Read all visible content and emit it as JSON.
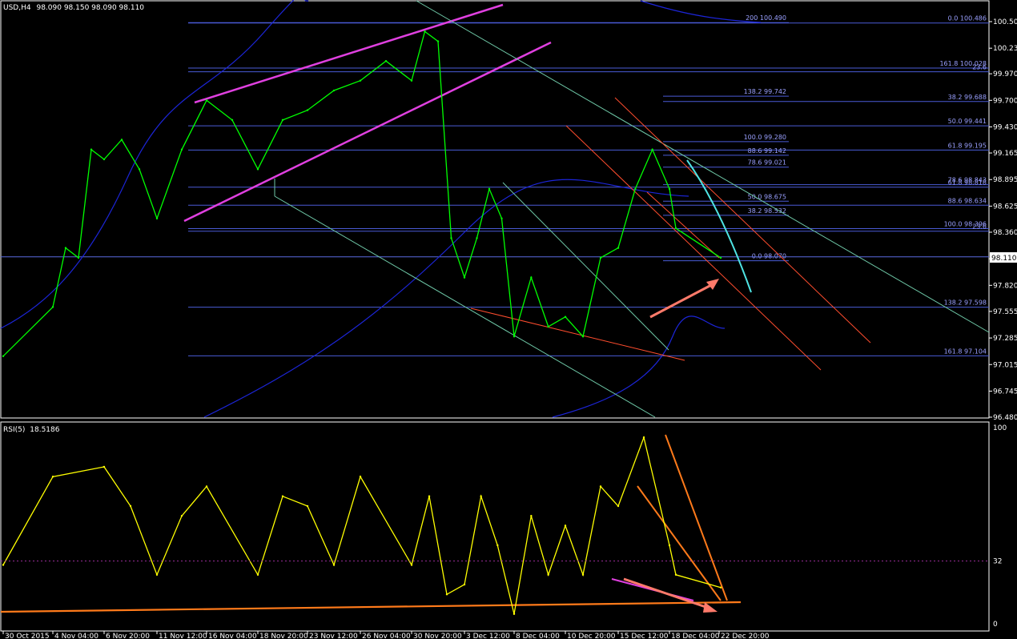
{
  "header": {
    "symbol": "USD,H4",
    "ohlc": "98.090 98.150 98.090 98.110"
  },
  "colors": {
    "background": "#000000",
    "price": "#00ff00",
    "rsi": "#ffff00",
    "fib_level": "#4a5bd6",
    "fib_text": "#9aa0ff",
    "moving_average": "#1c25d8",
    "channel": "#e040e0",
    "light_trend": "#6fc9a8",
    "orange_trend": "#ff7a1a",
    "red_trend": "#ff4d2e",
    "cyan_trend": "#4fe3e3",
    "arrow": "#ff7a6a",
    "frame": "#ffffff"
  },
  "chart_data": [
    {
      "type": "line",
      "title": "USD,H4",
      "y_axis_ticks": [
        "100.50",
        "100.23",
        "99.970",
        "99.700",
        "99.430",
        "99.165",
        "98.895",
        "98.625",
        "98.360",
        "98.090",
        "97.820",
        "97.555",
        "97.285",
        "97.015",
        "96.745",
        "96.480"
      ],
      "ylim": [
        96.48,
        100.53
      ],
      "current_price": "98.110",
      "x_axis_ticks": [
        "30 Oct 2015",
        "4 Nov 04:00",
        "6 Nov 20:00",
        "11 Nov 12:00",
        "16 Nov 04:00",
        "18 Nov 20:00",
        "23 Nov 12:00",
        "26 Nov 04:00",
        "30 Nov 20:00",
        "3 Dec 12:00",
        "8 Dec 04:00",
        "10 Dec 20:00",
        "15 Dec 12:00",
        "18 Dec 04:00",
        "22 Dec 20:00"
      ],
      "fib_levels": [
        {
          "label": "200 100.490",
          "value": 100.49
        },
        {
          "label": "0.0 100.486",
          "value": 100.486
        },
        {
          "label": "161.8 100.028",
          "value": 100.028
        },
        {
          "label": "23.6",
          "value": 99.99
        },
        {
          "label": "138.2 99.742",
          "value": 99.742
        },
        {
          "label": "38.2 99.688",
          "value": 99.688
        },
        {
          "label": "50.0 99.441",
          "value": 99.441
        },
        {
          "label": "100.0 99.280",
          "value": 99.28
        },
        {
          "label": "61.8 99.195",
          "value": 99.195
        },
        {
          "label": "88.6 99.142",
          "value": 99.142
        },
        {
          "label": "78.6 99.021",
          "value": 99.021
        },
        {
          "label": "78.6 98.843",
          "value": 98.843
        },
        {
          "label": "61.8 98.818",
          "value": 98.818
        },
        {
          "label": "50.0 98.675",
          "value": 98.675
        },
        {
          "label": "88.6 98.634",
          "value": 98.634
        },
        {
          "label": "38.2 98.532",
          "value": 98.532
        },
        {
          "label": "100.0 98.396",
          "value": 98.396
        },
        {
          "label": "23.6",
          "value": 98.37
        },
        {
          "label": "0.0 98.070",
          "value": 98.07
        },
        {
          "label": "138.2 97.598",
          "value": 97.598
        },
        {
          "label": "161.8 97.104",
          "value": 97.104
        }
      ],
      "price_path": [
        [
          "30 Oct 2015",
          97.1
        ],
        [
          "4 Nov 04:00",
          97.6
        ],
        [
          "4 Nov 12:00",
          98.2
        ],
        [
          "5 Nov",
          98.1
        ],
        [
          "6 Nov 00:00",
          99.2
        ],
        [
          "6 Nov 20:00",
          99.1
        ],
        [
          "9 Nov",
          99.3
        ],
        [
          "10 Nov",
          99.0
        ],
        [
          "11 Nov 12:00",
          98.5
        ],
        [
          "12 Nov",
          99.2
        ],
        [
          "16 Nov 04:00",
          99.7
        ],
        [
          "17 Nov",
          99.5
        ],
        [
          "18 Nov 20:00",
          99.0
        ],
        [
          "19 Nov",
          99.5
        ],
        [
          "23 Nov 12:00",
          99.6
        ],
        [
          "24 Nov",
          99.8
        ],
        [
          "26 Nov 04:00",
          99.9
        ],
        [
          "27 Nov",
          100.1
        ],
        [
          "30 Nov 20:00",
          99.9
        ],
        [
          "1 Dec",
          100.4
        ],
        [
          "2 Dec",
          100.3
        ],
        [
          "3 Dec 00:00",
          98.3
        ],
        [
          "3 Dec 12:00",
          97.9
        ],
        [
          "4 Dec",
          98.3
        ],
        [
          "6 Dec",
          98.8
        ],
        [
          "7 Dec",
          98.5
        ],
        [
          "8 Dec 04:00",
          97.3
        ],
        [
          "9 Dec",
          97.9
        ],
        [
          "10 Dec 04:00",
          97.4
        ],
        [
          "10 Dec 20:00",
          97.5
        ],
        [
          "11 Dec",
          97.3
        ],
        [
          "14 Dec",
          98.1
        ],
        [
          "15 Dec 12:00",
          98.2
        ],
        [
          "16 Dec",
          98.8
        ],
        [
          "17 Dec",
          99.2
        ],
        [
          "18 Dec 04:00",
          98.8
        ],
        [
          "21 Dec",
          98.4
        ],
        [
          "22 Dec 04:00",
          98.1
        ]
      ]
    },
    {
      "type": "line",
      "title": "RSI(5)",
      "value_label": "18.5186",
      "ylim": [
        0,
        100
      ],
      "y_axis_ticks": [
        "100",
        "32",
        "0"
      ],
      "levels": [
        32
      ],
      "rsi_path": [
        [
          "30 Oct 2015",
          30
        ],
        [
          "4 Nov 04:00",
          75
        ],
        [
          "6 Nov 20:00",
          80
        ],
        [
          "9 Nov",
          60
        ],
        [
          "11 Nov 12:00",
          25
        ],
        [
          "12 Nov",
          55
        ],
        [
          "16 Nov 04:00",
          70
        ],
        [
          "18 Nov 20:00",
          25
        ],
        [
          "19 Nov",
          65
        ],
        [
          "23 Nov 12:00",
          60
        ],
        [
          "24 Nov",
          30
        ],
        [
          "26 Nov 04:00",
          75
        ],
        [
          "30 Nov 20:00",
          30
        ],
        [
          "1 Dec",
          65
        ],
        [
          "3 Dec 00:00",
          15
        ],
        [
          "3 Dec 12:00",
          20
        ],
        [
          "4 Dec",
          65
        ],
        [
          "7 Dec",
          40
        ],
        [
          "8 Dec 04:00",
          5
        ],
        [
          "9 Dec",
          55
        ],
        [
          "10 Dec 04:00",
          25
        ],
        [
          "10 Dec 20:00",
          50
        ],
        [
          "11 Dec",
          25
        ],
        [
          "14 Dec",
          70
        ],
        [
          "15 Dec 12:00",
          60
        ],
        [
          "17 Dec",
          95
        ],
        [
          "18 Dec 04:00",
          40
        ],
        [
          "21 Dec",
          25
        ],
        [
          "22 Dec 04:00",
          18.5
        ]
      ]
    }
  ]
}
